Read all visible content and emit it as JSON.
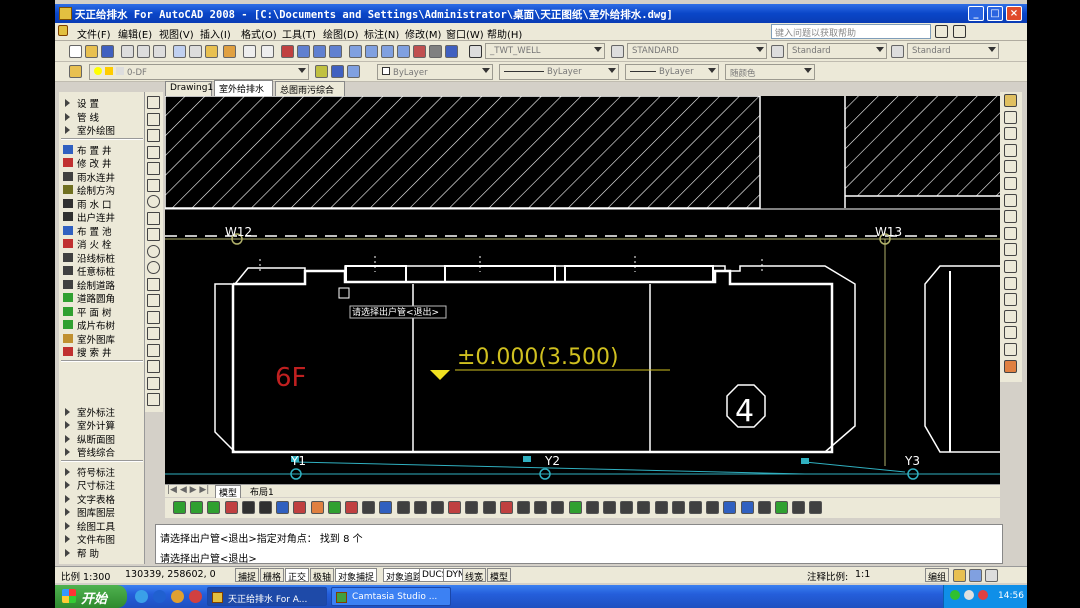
{
  "window": {
    "title": "天正给排水 For AutoCAD 2008 - [C:\\Documents and Settings\\Administrator\\桌面\\天正图纸\\室外给排水.dwg]",
    "minimize": "_",
    "maximize": "□",
    "close": "×"
  },
  "menu": {
    "items": [
      "文件(F)",
      "编辑(E)",
      "视图(V)",
      "插入(I)",
      "格式(O)",
      "工具(T)",
      "绘图(D)",
      "标注(N)",
      "修改(M)",
      "窗口(W)",
      "帮助(H)"
    ],
    "search_placeholder": "键入问题以获取帮助"
  },
  "toolbar": {
    "textstyle": "_TWT_WELL",
    "dimstyle": "STANDARD",
    "tablestyle": "Standard",
    "mlstyle": "Standard",
    "layer": "0-DF",
    "color": "ByLayer",
    "linetype": "ByLayer",
    "lineweight": "ByLayer",
    "plotstyle": "随颜色"
  },
  "left_panel": {
    "items": [
      {
        "label": "设    置",
        "icon": "triangle-icon",
        "kind": "header"
      },
      {
        "label": "管    线",
        "icon": "triangle-icon",
        "kind": "header"
      },
      {
        "label": "室外绘图",
        "icon": "triangle-icon",
        "kind": "header"
      },
      {
        "label": "布 置 井",
        "icon": "well-icon",
        "kind": "item"
      },
      {
        "label": "修 改 井",
        "icon": "edit-well-icon",
        "kind": "item"
      },
      {
        "label": "雨水连井",
        "icon": "rain-link-icon",
        "kind": "item"
      },
      {
        "label": "绘制方沟",
        "icon": "ditch-icon",
        "kind": "item"
      },
      {
        "label": "雨 水 口",
        "icon": "rain-inlet-icon",
        "kind": "item"
      },
      {
        "label": "出户连井",
        "icon": "outlet-link-icon",
        "kind": "item"
      },
      {
        "label": "布 置 池",
        "icon": "pool-icon",
        "kind": "item"
      },
      {
        "label": "消 火 栓",
        "icon": "hydrant-icon",
        "kind": "item"
      },
      {
        "label": "沿线标桩",
        "icon": "stake-line-icon",
        "kind": "item"
      },
      {
        "label": "任意标桩",
        "icon": "stake-any-icon",
        "kind": "item"
      },
      {
        "label": "绘制道路",
        "icon": "road-icon",
        "kind": "item"
      },
      {
        "label": "道路圆角",
        "icon": "road-fillet-icon",
        "kind": "item"
      },
      {
        "label": "平 面 树",
        "icon": "tree-icon",
        "kind": "item"
      },
      {
        "label": "成片布树",
        "icon": "trees-icon",
        "kind": "item"
      },
      {
        "label": "室外图库",
        "icon": "library-icon",
        "kind": "item"
      },
      {
        "label": "搜 索 井",
        "icon": "search-icon",
        "kind": "item"
      },
      {
        "label": "室外标注",
        "icon": "triangle-icon",
        "kind": "header"
      },
      {
        "label": "室外计算",
        "icon": "triangle-icon",
        "kind": "header"
      },
      {
        "label": "纵断面图",
        "icon": "triangle-icon",
        "kind": "header"
      },
      {
        "label": "管线综合",
        "icon": "triangle-icon",
        "kind": "header"
      },
      {
        "label": "符号标注",
        "icon": "triangle-icon",
        "kind": "header"
      },
      {
        "label": "尺寸标注",
        "icon": "triangle-icon",
        "kind": "header"
      },
      {
        "label": "文字表格",
        "icon": "triangle-icon",
        "kind": "header"
      },
      {
        "label": "图库图层",
        "icon": "triangle-icon",
        "kind": "header"
      },
      {
        "label": "绘图工具",
        "icon": "triangle-icon",
        "kind": "header"
      },
      {
        "label": "文件布图",
        "icon": "triangle-icon",
        "kind": "header"
      },
      {
        "label": "帮    助",
        "icon": "triangle-icon",
        "kind": "header"
      }
    ]
  },
  "doc_tabs": [
    "Drawing1",
    "室外给排水",
    "总图雨污综合"
  ],
  "active_tab": "室外给排水",
  "drawing": {
    "labels": {
      "w12": "W12",
      "w13": "W13",
      "floor": "6F",
      "elevation": "±0.000(3.500)",
      "building_no": "4",
      "y1": "Y1",
      "y2": "Y2",
      "y3": "Y3",
      "tooltip": "请选择出户管<退出>"
    },
    "colors": {
      "background": "#000000",
      "wall": "#ffffff",
      "pipe_line": "#b0b06a",
      "drain_line": "#30b0c0",
      "floor_text": "#c02020",
      "elevation_text": "#d0c020",
      "marker": "#f0e020"
    }
  },
  "layout_tabs": [
    "模型",
    "布局1"
  ],
  "command": {
    "line1": "请选择出户管<退出>指定对角点： 找到 8 个",
    "line2": "请选择出户管<退出>"
  },
  "status": {
    "scale": "比例 1:300",
    "coords": "130339, 258602, 0",
    "toggles": [
      "捕捉",
      "栅格",
      "正交",
      "极轴",
      "对象捕捉",
      "对象追踪",
      "DUCS",
      "DYN",
      "线宽",
      "模型"
    ],
    "annotation_scale": "注释比例:",
    "annotation_value": "1:1",
    "layout_mode": "编组"
  },
  "taskbar": {
    "start": "开始",
    "tasks": [
      "天正给排水 For A...",
      "Camtasia Studio ..."
    ],
    "clock": "14:56"
  }
}
